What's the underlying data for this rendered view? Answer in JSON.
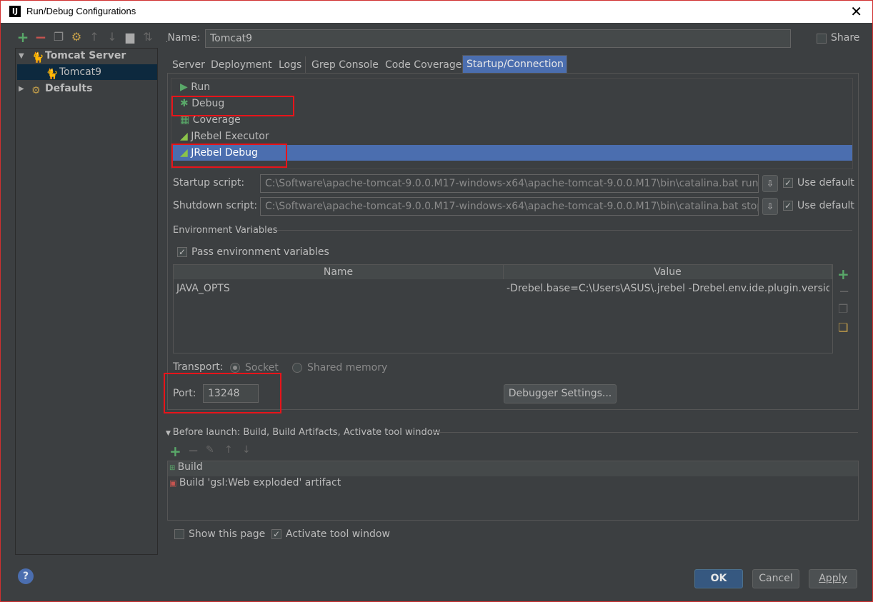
{
  "window": {
    "title": "Run/Debug Configurations",
    "app_icon": "IJ",
    "close": "✕"
  },
  "tree": {
    "tomcat_server": "Tomcat Server",
    "tomcat9": "Tomcat9",
    "defaults": "Defaults"
  },
  "name": {
    "label": "Name:",
    "value": "Tomcat9"
  },
  "share": {
    "label": "Share"
  },
  "tabs": [
    "Server",
    "Deployment",
    "Logs",
    "Grep Console",
    "Code Coverage",
    "Startup/Connection"
  ],
  "executors": [
    "Run",
    "Debug",
    "Coverage",
    "JRebel Executor",
    "JRebel Debug"
  ],
  "startup": {
    "label": "Startup script:",
    "value": "C:\\Software\\apache-tomcat-9.0.0.M17-windows-x64\\apache-tomcat-9.0.0.M17\\bin\\catalina.bat run",
    "use_default": "Use default"
  },
  "shutdown": {
    "label": "Shutdown script:",
    "value": "C:\\Software\\apache-tomcat-9.0.0.M17-windows-x64\\apache-tomcat-9.0.0.M17\\bin\\catalina.bat stop",
    "use_default": "Use default"
  },
  "env": {
    "section": "Environment Variables",
    "pass": "Pass environment variables",
    "col_name": "Name",
    "col_value": "Value",
    "row_name": "JAVA_OPTS",
    "row_value": "-Drebel.base=C:\\Users\\ASUS\\.jrebel -Drebel.env.ide.plugin.version..."
  },
  "transport": {
    "label": "Transport:",
    "socket": "Socket",
    "shared": "Shared memory"
  },
  "port": {
    "label": "Port:",
    "value": "13248"
  },
  "debugger_settings": "Debugger Settings...",
  "before_launch": {
    "title": "Before launch: Build, Build Artifacts, Activate tool window",
    "items": [
      "Build",
      "Build 'gsl:Web exploded' artifact"
    ]
  },
  "show_page": "Show this page",
  "activate_tool": "Activate tool window",
  "buttons": {
    "ok": "OK",
    "cancel": "Cancel",
    "apply": "Apply"
  },
  "help": "?",
  "colors": {
    "accent": "#4b6eaf",
    "highlight": "#e8141a",
    "add": "#59a869",
    "remove": "#c75450"
  }
}
